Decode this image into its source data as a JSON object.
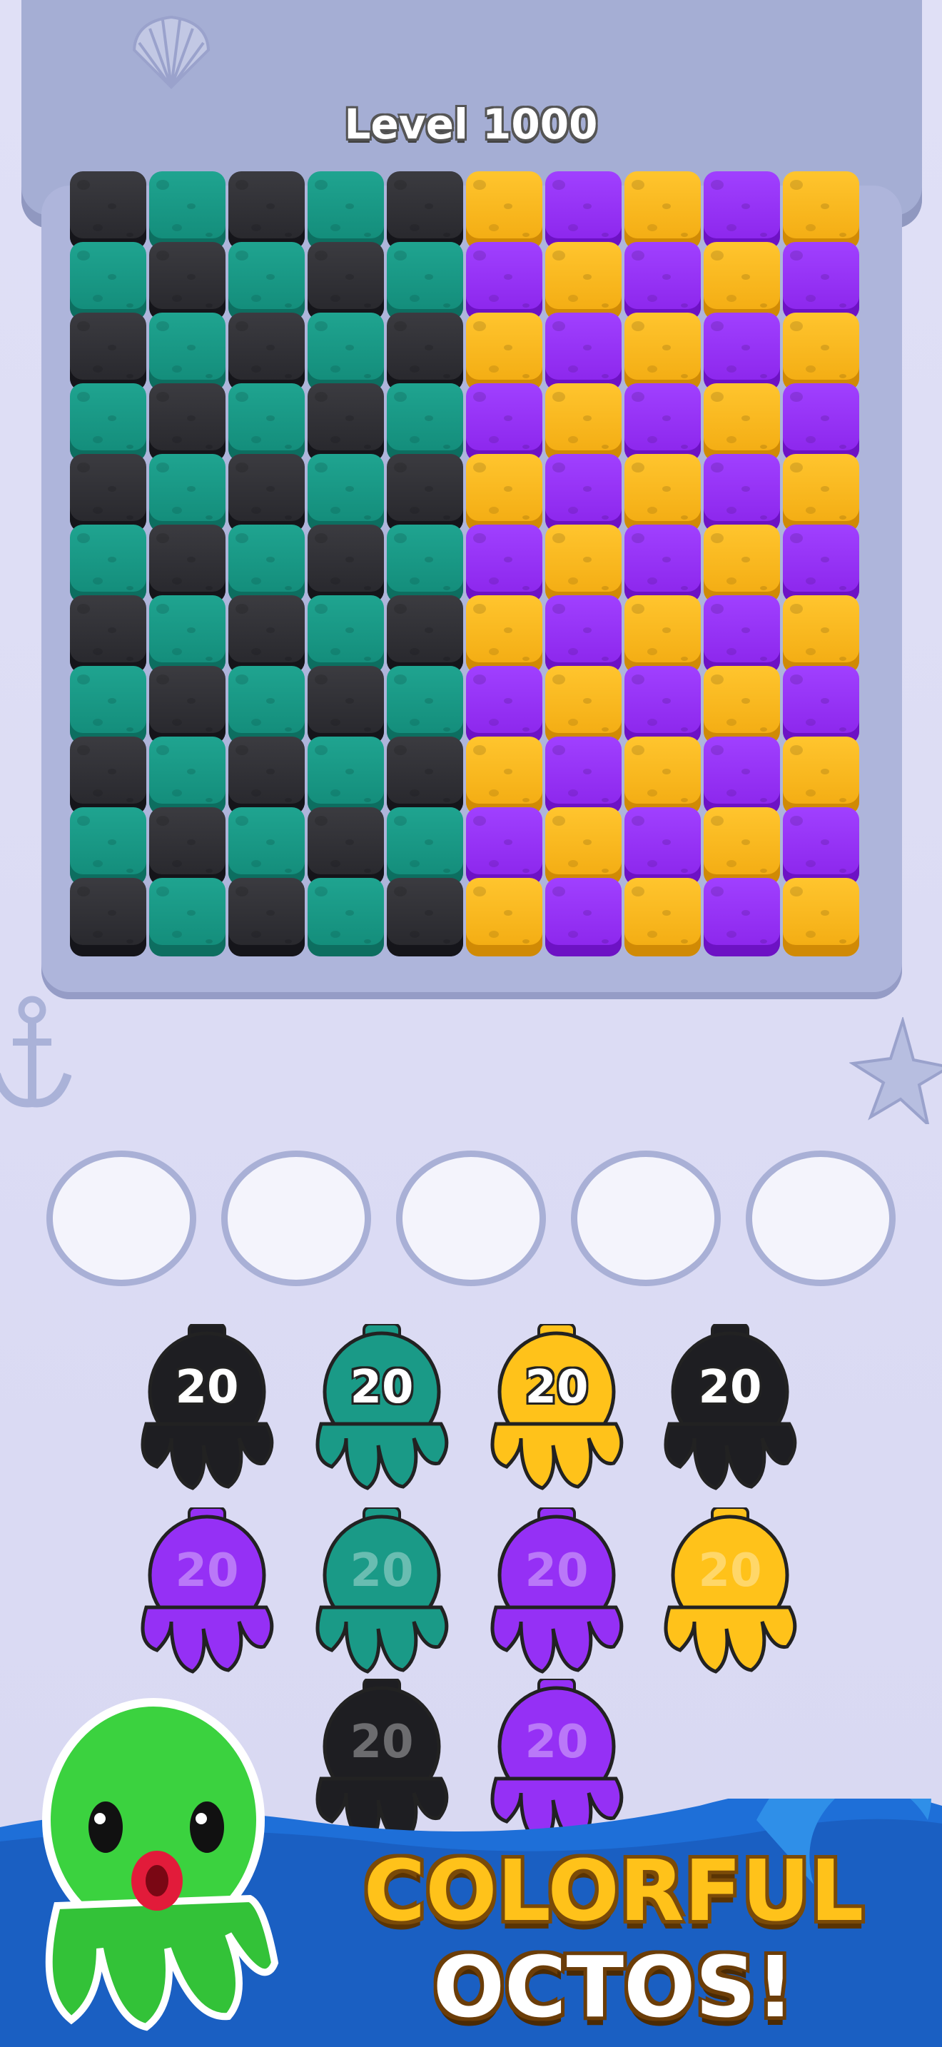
{
  "header": {
    "level_label": "Level 1000"
  },
  "board": {
    "rows": 11,
    "cols": 10,
    "colors": {
      "teal": "#1fa490",
      "black": "#2f2f34",
      "yellow": "#ffc21a",
      "purple": "#9530f5"
    },
    "left_block_colors": [
      "black",
      "teal"
    ],
    "right_block_colors": [
      "purple",
      "yellow"
    ]
  },
  "slots": {
    "count": 5,
    "state": "empty"
  },
  "octopi": [
    {
      "color": "black",
      "count": "20",
      "active": true
    },
    {
      "color": "teal",
      "count": "20",
      "active": true
    },
    {
      "color": "yellow",
      "count": "20",
      "active": true
    },
    {
      "color": "black",
      "count": "20",
      "active": true
    },
    {
      "color": "purple",
      "count": "20",
      "active": false
    },
    {
      "color": "teal",
      "count": "20",
      "active": false
    },
    {
      "color": "purple",
      "count": "20",
      "active": false
    },
    {
      "color": "yellow",
      "count": "20",
      "active": false
    },
    {
      "color": "black",
      "count": "20",
      "active": false
    },
    {
      "color": "purple",
      "count": "20",
      "active": false
    }
  ],
  "promo": {
    "line1": "COLORFUL",
    "line2": "OCTOS!",
    "accent": "#ffc21a",
    "water": "#1e6fd8"
  },
  "decor": [
    "shell-icon",
    "anchor-icon",
    "starfish-icon",
    "wave-icon",
    "octopus-mascot-icon"
  ]
}
